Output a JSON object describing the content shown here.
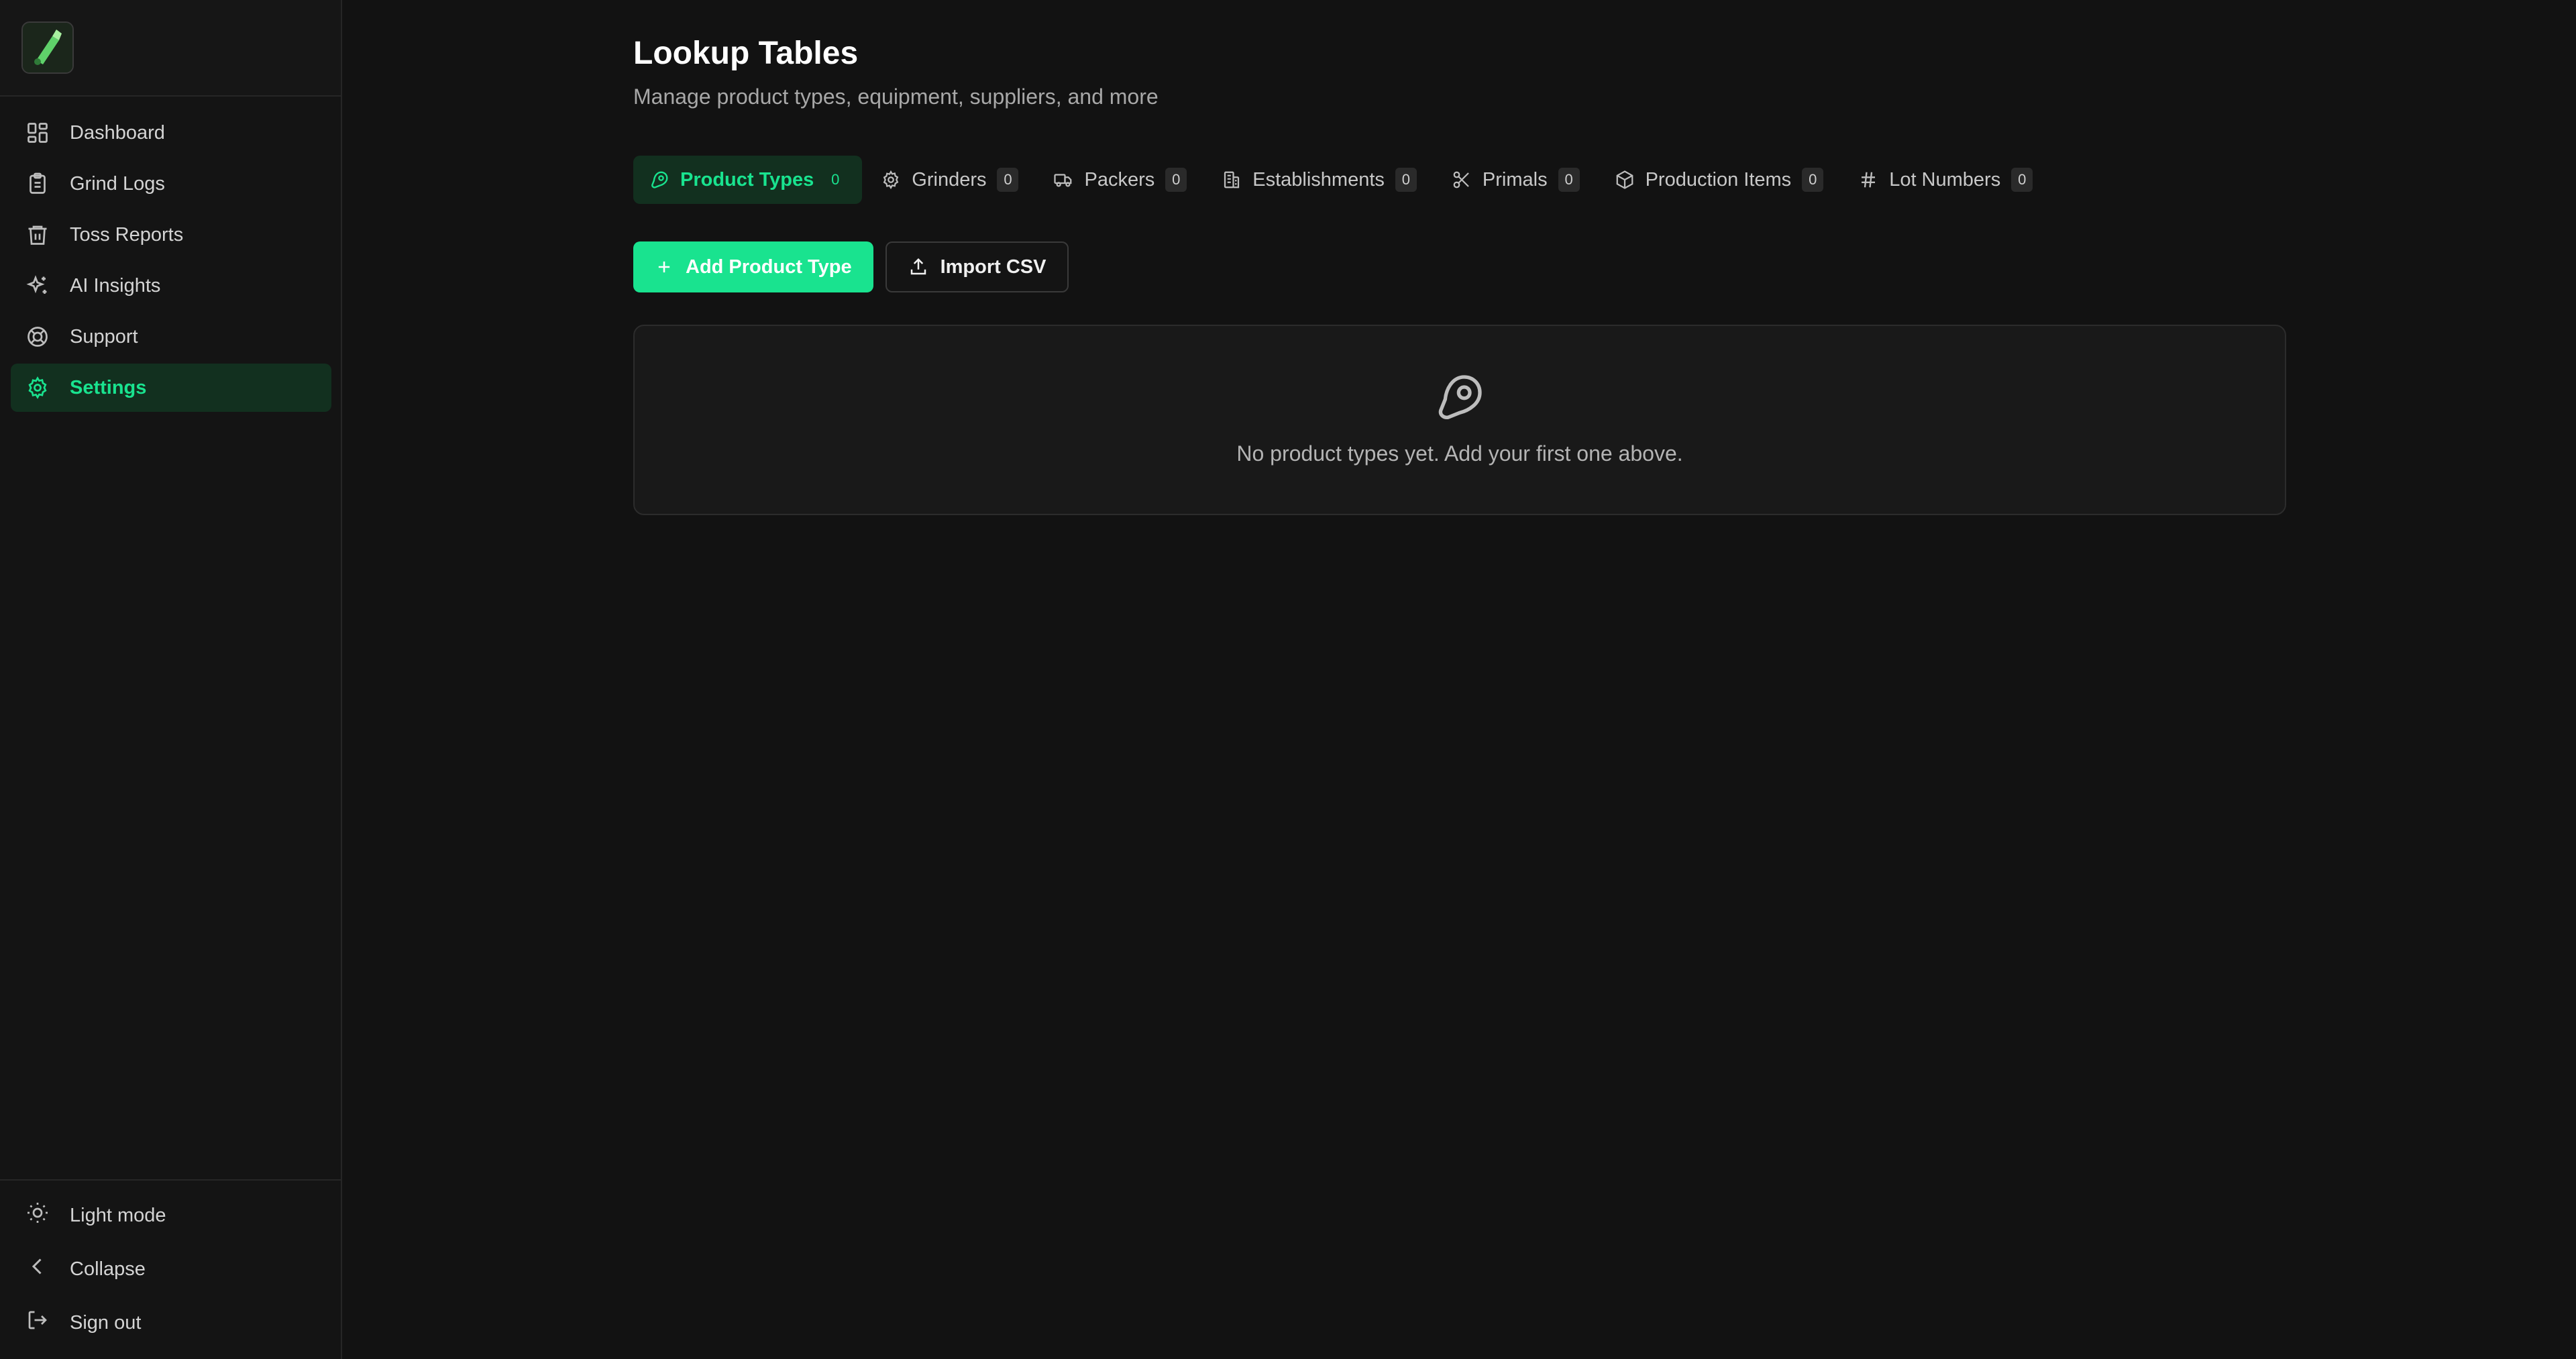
{
  "sidebar": {
    "nav": [
      {
        "label": "Dashboard",
        "icon": "dashboard-icon"
      },
      {
        "label": "Grind Logs",
        "icon": "clipboard-icon"
      },
      {
        "label": "Toss Reports",
        "icon": "trash-icon"
      },
      {
        "label": "AI Insights",
        "icon": "sparkles-icon"
      },
      {
        "label": "Support",
        "icon": "lifebuoy-icon"
      },
      {
        "label": "Settings",
        "icon": "gear-icon",
        "active": true
      }
    ],
    "bottom": [
      {
        "label": "Light mode",
        "icon": "sun-icon"
      },
      {
        "label": "Collapse",
        "icon": "chevron-left-icon"
      },
      {
        "label": "Sign out",
        "icon": "sign-out-icon"
      }
    ]
  },
  "header": {
    "title": "Lookup Tables",
    "subtitle": "Manage product types, equipment, suppliers, and more"
  },
  "tabs": [
    {
      "label": "Product Types",
      "count": "0",
      "icon": "meat-icon",
      "active": true
    },
    {
      "label": "Grinders",
      "count": "0",
      "icon": "cog-icon"
    },
    {
      "label": "Packers",
      "count": "0",
      "icon": "truck-icon"
    },
    {
      "label": "Establishments",
      "count": "0",
      "icon": "building-icon"
    },
    {
      "label": "Primals",
      "count": "0",
      "icon": "scissors-icon"
    },
    {
      "label": "Production Items",
      "count": "0",
      "icon": "box-icon"
    },
    {
      "label": "Lot Numbers",
      "count": "0",
      "icon": "hash-icon"
    }
  ],
  "actions": {
    "add_label": "Add Product Type",
    "import_label": "Import CSV"
  },
  "empty_state": {
    "message": "No product types yet. Add your first one above.",
    "icon": "meat-icon"
  },
  "colors": {
    "accent": "#19e38f",
    "background": "#121212",
    "active_bg": "#12301f"
  }
}
